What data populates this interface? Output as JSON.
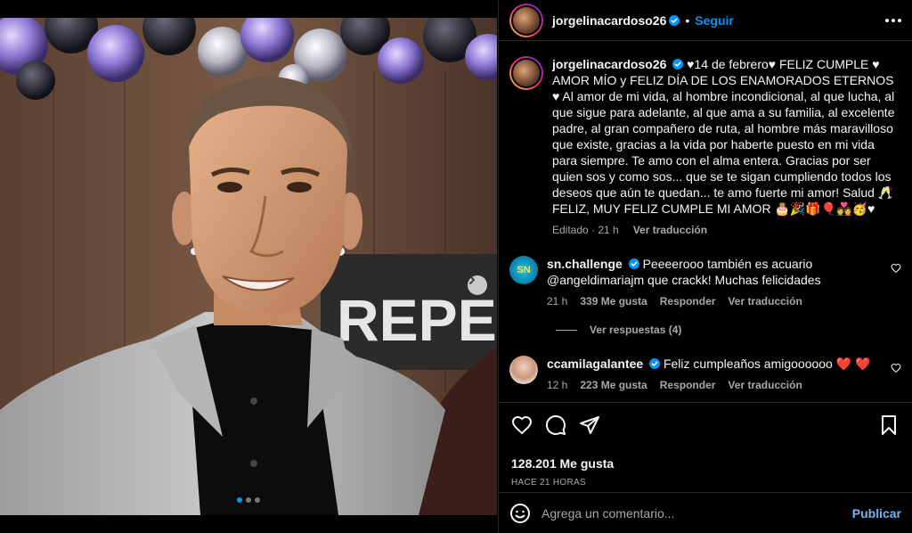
{
  "post": {
    "username": "jorgelinacardoso26",
    "separator": "•",
    "follow_label": "Seguir"
  },
  "media": {
    "sign_text": "REPERI",
    "carousel": {
      "count": 3,
      "active": 1
    }
  },
  "caption": {
    "username": "jorgelinacardoso26",
    "text": "♥14 de febrero♥ FELIZ CUMPLE ♥ AMOR MÍO y FELIZ DÍA DE LOS ENAMORADOS ETERNOS ♥ Al amor de mi vida, al hombre incondicional, al que lucha, al que sigue para adelante, al que ama a su familia, al excelente padre, al gran compañero de ruta, al hombre más maravilloso que existe, gracias a la vida por haberte puesto en mi vida para siempre. Te amo con el alma entera. Gracias por ser quien sos y como sos... que se te sigan cumpliendo todos los deseos que aún te quedan... te amo fuerte mi amor! Salud 🥂 FELIZ, MUY FELIZ CUMPLE MI AMOR 🎂🎉🎁🎈💑🥳♥",
    "edited": "Editado · 21 h",
    "translate": "Ver traducción"
  },
  "comments": [
    {
      "username": "sn.challenge",
      "text": "Peeeerooo también es acuario @angeldimariajm que crackk! Muchas felicidades",
      "time": "21 h",
      "likes": "339 Me gusta",
      "reply": "Responder",
      "translate": "Ver traducción",
      "view_replies": "Ver respuestas (4)",
      "avatar_text": "SN"
    },
    {
      "username": "ccamilagalantee",
      "text": "Feliz cumpleaños amigoooooo ❤️ ❤️",
      "time": "12 h",
      "likes": "223 Me gusta",
      "reply": "Responder",
      "translate": "Ver traducción"
    }
  ],
  "stats": {
    "likes": "128.201 Me gusta",
    "posted": "HACE 21 HORAS"
  },
  "composer": {
    "placeholder": "Agrega un comentario...",
    "publish": "Publicar"
  },
  "colors": {
    "accent": "#0095f6",
    "publish": "#6fb8f4",
    "muted": "#a8a8a8",
    "border": "#262626",
    "heart_red": "#ed4956"
  }
}
